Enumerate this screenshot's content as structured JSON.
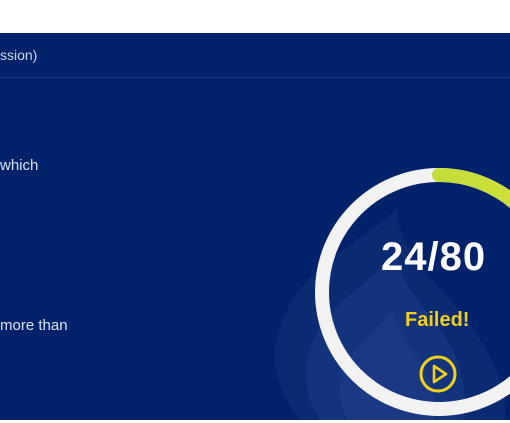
{
  "panel": {
    "header_text": "ssion)",
    "line_1": "which",
    "line_2": "more than"
  },
  "result": {
    "score": "24/80",
    "status": "Failed!",
    "fraction": 0.3,
    "play_icon": "play-circle-icon"
  },
  "colors": {
    "background": "#00226b",
    "ring_track": "#f2f2f2",
    "ring_progress_start": "#8fd13a",
    "ring_progress_end": "#d7e13a",
    "status": "#f0d01a",
    "score_text": "#ffffff"
  }
}
